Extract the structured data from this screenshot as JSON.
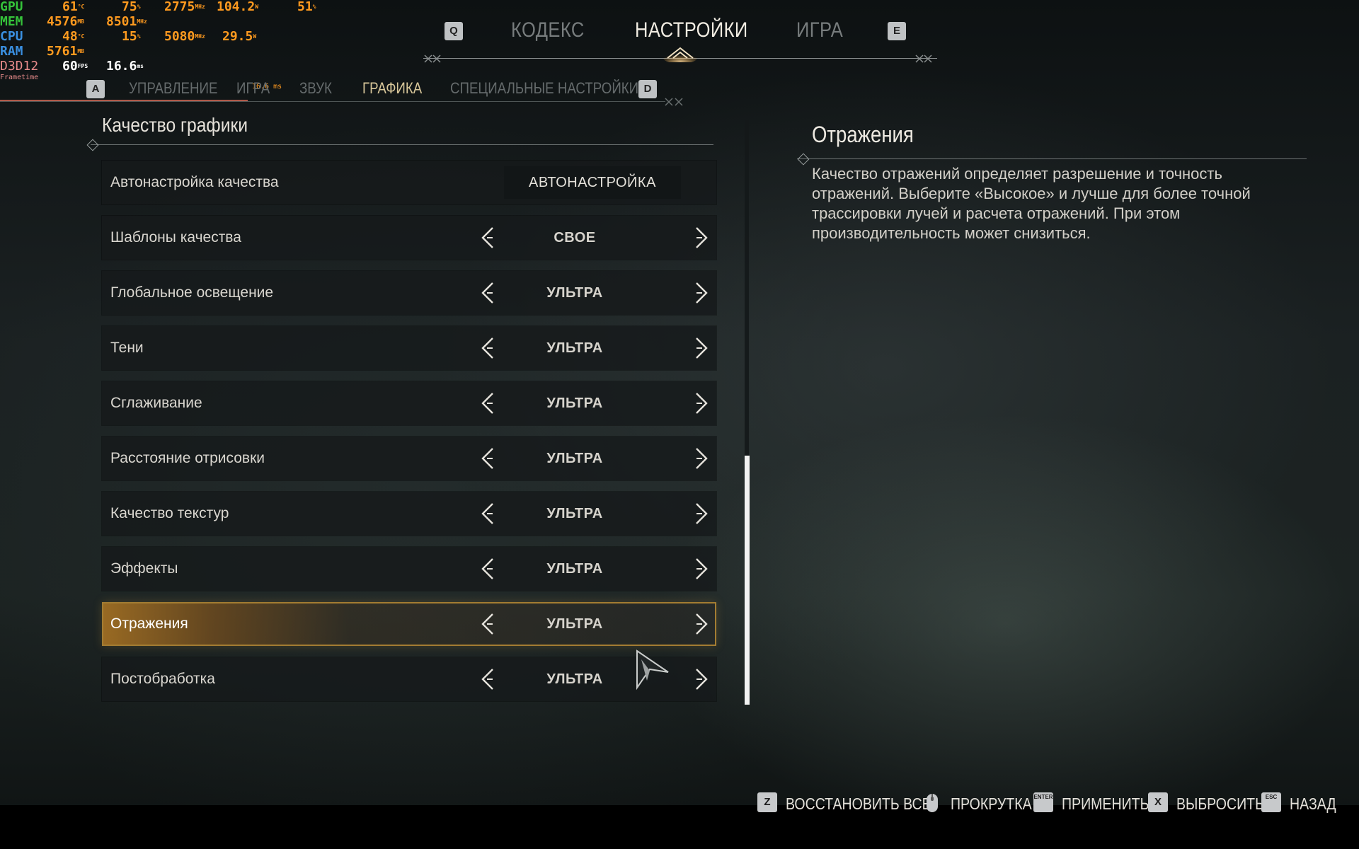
{
  "overlay": {
    "gpu": {
      "name": "GPU",
      "temp": "61",
      "temp_unit": "°C",
      "load": "75",
      "load_unit": "%",
      "clock": "2775",
      "clock_unit": "MHz",
      "power": "104.2",
      "power_unit": "W",
      "extra": "51",
      "extra_unit": "%"
    },
    "mem": {
      "name": "MEM",
      "used": "4576",
      "used_unit": "MB",
      "clock": "8501",
      "clock_unit": "MHz"
    },
    "cpu": {
      "name": "CPU",
      "temp": "48",
      "temp_unit": "°C",
      "load": "15",
      "load_unit": "%",
      "clock": "5080",
      "clock_unit": "MHz",
      "power": "29.5",
      "power_unit": "W"
    },
    "ram": {
      "name": "RAM",
      "used": "5761",
      "used_unit": "MB"
    },
    "d3d": {
      "name": "D3D12",
      "fps": "60",
      "fps_unit": "FPS",
      "frametime": "16.6",
      "frametime_unit": "ms"
    },
    "frametime_label": "Frametime",
    "frametime_graph_label": "16.6 ms"
  },
  "top_nav": {
    "key_left": "Q",
    "key_right": "E",
    "items": [
      {
        "label": "КОДЕКС"
      },
      {
        "label": "НАСТРОЙКИ"
      },
      {
        "label": "ИГРА"
      }
    ],
    "active": "НАСТРОЙКИ"
  },
  "sub_nav": {
    "key_left": "A",
    "key_right": "D",
    "items": [
      {
        "label": "УПРАВЛЕНИЕ"
      },
      {
        "label": "ИГРА"
      },
      {
        "label": "ЗВУК"
      },
      {
        "label": "ГРАФИКА"
      },
      {
        "label": "СПЕЦИАЛЬНЫЕ НАСТРОЙКИ"
      }
    ],
    "active": "ГРАФИКА"
  },
  "section_title": "Качество графики",
  "settings": [
    {
      "label": "Автонастройка качества",
      "value": "АВТОНАСТРОЙКА",
      "kind": "button"
    },
    {
      "label": "Шаблоны качества",
      "value": "СВОЕ",
      "kind": "select"
    },
    {
      "label": "Глобальное освещение",
      "value": "УЛЬТРА",
      "kind": "select"
    },
    {
      "label": "Тени",
      "value": "УЛЬТРА",
      "kind": "select"
    },
    {
      "label": "Сглаживание",
      "value": "УЛЬТРА",
      "kind": "select"
    },
    {
      "label": "Расстояние отрисовки",
      "value": "УЛЬТРА",
      "kind": "select"
    },
    {
      "label": "Качество текстур",
      "value": "УЛЬТРА",
      "kind": "select"
    },
    {
      "label": "Эффекты",
      "value": "УЛЬТРА",
      "kind": "select"
    },
    {
      "label": "Отражения",
      "value": "УЛЬТРА",
      "kind": "select",
      "selected": true
    },
    {
      "label": "Постобработка",
      "value": "УЛЬТРА",
      "kind": "select"
    }
  ],
  "detail": {
    "title": "Отражения",
    "text": "Качество отражений определяет разрешение и точность отражений. Выберите «Высокое» и лучше для более точной трассировки лучей и расчета отражений. При этом производительность может снизиться."
  },
  "bottom_hints": [
    {
      "key": "Z",
      "label": "ВОССТАНОВИТЬ ВСЕ",
      "icon": "key-z-icon"
    },
    {
      "key": "",
      "label": "ПРОКРУТКА",
      "icon": "mouse-icon"
    },
    {
      "key": "ENTER",
      "label": "ПРИМЕНИТЬ",
      "icon": "key-enter-icon"
    },
    {
      "key": "X",
      "label": "ВЫБРОСИТЬ",
      "icon": "key-x-icon"
    },
    {
      "key": "ESC",
      "label": "НАЗАД",
      "icon": "key-esc-icon"
    }
  ],
  "colors": {
    "accent": "#d8c79a",
    "selected_row": "#a37c32",
    "overlay_orange": "#ff9a1f",
    "overlay_green": "#3bbf3b",
    "overlay_blue": "#3a8fe0"
  }
}
